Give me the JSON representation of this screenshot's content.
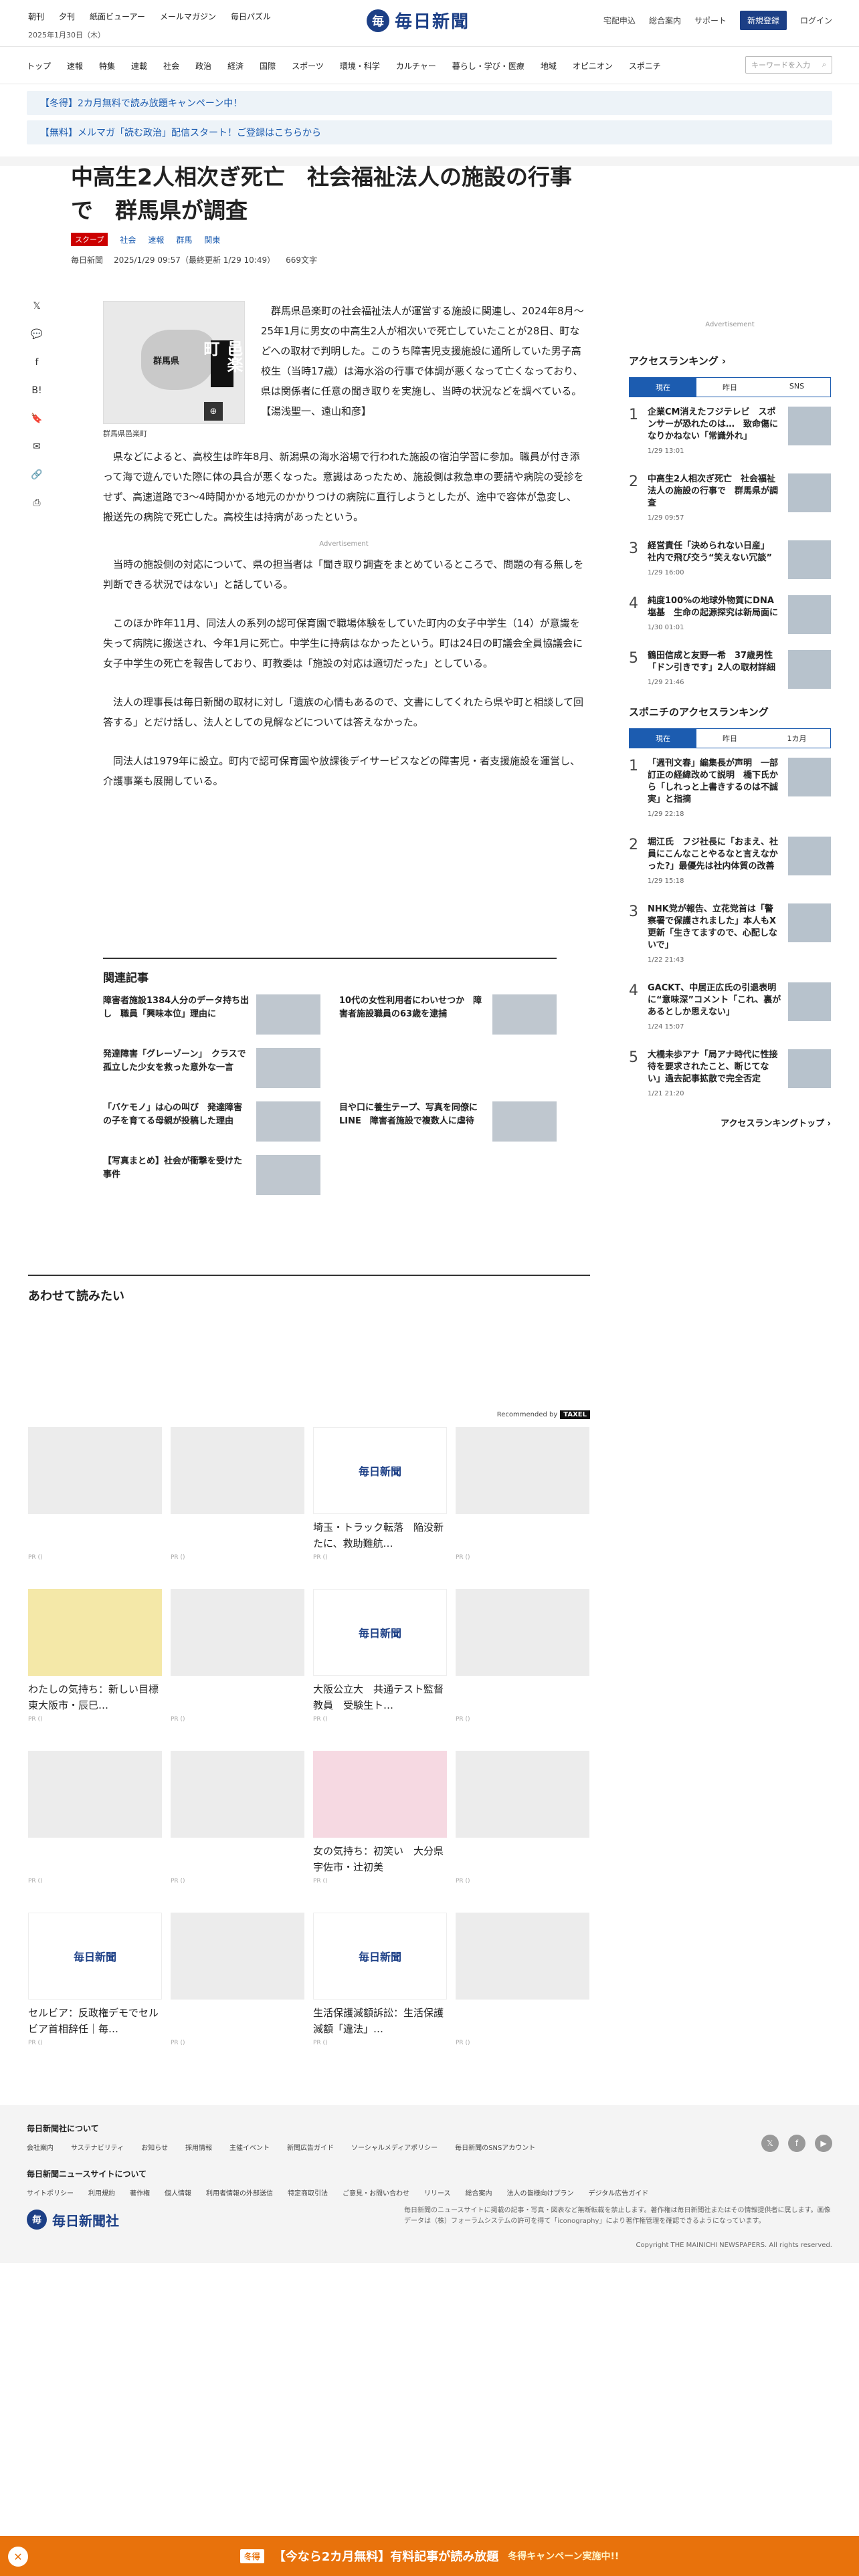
{
  "header": {
    "links": [
      "朝刊",
      "夕刊",
      "紙面ビューアー",
      "メールマガジン",
      "毎日パズル"
    ],
    "date": "2025年1月30日（木）",
    "logo": "毎日新聞",
    "right_links": [
      "宅配申込",
      "総合案内",
      "サポート"
    ],
    "register": "新規登録",
    "login": "ログイン"
  },
  "nav": {
    "items": [
      "トップ",
      "速報",
      "特集",
      "連載",
      "社会",
      "政治",
      "経済",
      "国際",
      "スポーツ",
      "環境・科学",
      "カルチャー",
      "暮らし・学び・医療",
      "地域",
      "オピニオン",
      "スポニチ"
    ],
    "search_placeholder": "キーワードを入力"
  },
  "banners": [
    "【冬得】2カ月無料で読み放題キャンペーン中！",
    "【無料】メルマガ「読む政治」配信スタート！ご登録はこちらから"
  ],
  "article": {
    "title": "中高生2人相次ぎ死亡　社会福祉法人の施設の行事で　群馬県が調査",
    "scoop": "スクープ",
    "tags": [
      "社会",
      "速報",
      "群馬",
      "関東"
    ],
    "source": "毎日新聞",
    "time": "2025/1/29 09:57（最終更新 1/29 10:49）",
    "chars": "669文字",
    "map_pref": "群馬県",
    "map_town": "邑楽町",
    "caption": "群馬県邑楽町",
    "paragraphs": [
      "群馬県邑楽町の社会福祉法人が運営する施設に関連し、2024年8月～25年1月に男女の中高生2人が相次いで死亡していたことが28日、町などへの取材で判明した。このうち障害児支援施設に通所していた男子高校生（当時17歳）は海水浴の行事で体調が悪くなって亡くなっており、県は関係者に任意の聞き取りを実施し、当時の状況などを調べている。【湯浅聖一、遠山和彦】",
      "県などによると、高校生は昨年8月、新潟県の海水浴場で行われた施設の宿泊学習に参加。職員が付き添って海で遊んでいた際に体の具合が悪くなった。意識はあったため、施設側は救急車の要請や病院の受診をせず、高速道路で3～4時間かかる地元のかかりつけの病院に直行しようとしたが、途中で容体が急変し、搬送先の病院で死亡した。高校生は持病があったという。",
      "当時の施設側の対応について、県の担当者は「聞き取り調査をまとめているところで、問題の有る無しを判断できる状況ではない」と話している。",
      "このほか昨年11月、同法人の系列の認可保育園で職場体験をしていた町内の女子中学生（14）が意識を失って病院に搬送され、今年1月に死亡。中学生に持病はなかったという。町は24日の町議会全員協議会に女子中学生の死亡を報告しており、町教委は「施設の対応は適切だった」としている。",
      "法人の理事長は毎日新聞の取材に対し「遺族の心情もあるので、文書にしてくれたら県や町と相談して回答する」とだけ話し、法人としての見解などについては答えなかった。",
      "同法人は1979年に設立。町内で認可保育園や放課後デイサービスなどの障害児・者支援施設を運営し、介護事業も展開している。"
    ],
    "ad_label": "Advertisement"
  },
  "related": {
    "heading": "関連記事",
    "items": [
      "障害者施設1384人分のデータ持ち出し　職員「興味本位」理由に",
      "10代の女性利用者にわいせつか　障害者施設職員の63歳を逮捕",
      "発達障害「グレーゾーン」　クラスで孤立した少女を救った意外な一言",
      "「バケモノ」は心の叫び　発達障害の子を育てる母親が投稿した理由",
      "目や口に養生テープ、写真を同僚にLINE　障害者施設で複数人に虐待",
      "【写真まとめ】社会が衝撃を受けた事件"
    ]
  },
  "recommend": {
    "heading": "あわせて読みたい",
    "by": "Recommended by",
    "by_brand": "TAXEL",
    "pr": "PR ()",
    "cards": [
      "",
      "",
      "埼玉・トラック転落　陥没新たに、救助難航…",
      "",
      "",
      "わたしの気持ち：新しい目標　東大阪市・辰巳…",
      "大阪公立大　共通テスト監督教員　受験生ト…",
      "",
      "",
      "",
      "女の気持ち：初笑い　大分県宇佐市・辻初美",
      "",
      "セルビア：反政権デモでセルビア首相辞任｜毎…",
      "",
      "生活保護減額訴訟：生活保護減額「違法」…",
      ""
    ]
  },
  "sidebar": {
    "ad": "Advertisement",
    "ranking_title": "アクセスランキング",
    "tabs": [
      "現在",
      "昨日",
      "SNS"
    ],
    "items": [
      {
        "n": "1",
        "t": "企業CM消えたフジテレビ　スポンサーが恐れたのは…　致命傷になりかねない「常識外れ」",
        "time": "1/29 13:01"
      },
      {
        "n": "2",
        "t": "中高生2人相次ぎ死亡　社会福祉法人の施設の行事で　群馬県が調査",
        "time": "1/29 09:57"
      },
      {
        "n": "3",
        "t": "経営責任「決められない日産」　社内で飛び交う“笑えない冗談”",
        "time": "1/29 16:00"
      },
      {
        "n": "4",
        "t": "純度100%の地球外物質にDNA塩基　生命の起源探究は新局面に",
        "time": "1/30 01:01"
      },
      {
        "n": "5",
        "t": "鶴田信成と友野一希　37歳男性「ドン引きです」2人の取材詳細",
        "time": "1/29 21:46"
      }
    ],
    "sponichi_title": "スポニチのアクセスランキング",
    "sponichi_tabs": [
      "現在",
      "昨日",
      "1カ月"
    ],
    "sponichi": [
      {
        "n": "1",
        "t": "「週刊文春」編集長が声明　一部訂正の経緯改めて説明　橋下氏から「しれっと上書きするのは不誠実」と指摘",
        "time": "1/29 22:18"
      },
      {
        "n": "2",
        "t": "堀江氏　フジ社長に「おまえ、社員にこんなことやるなと言えなかった?」最優先は社内体質の改善",
        "time": "1/29 15:18"
      },
      {
        "n": "3",
        "t": "NHK党が報告、立花党首は「警察署で保護されました」本人もX更新「生きてますので、心配しないで」",
        "time": "1/22 21:43"
      },
      {
        "n": "4",
        "t": "GACKT、中居正広氏の引退表明に“意味深”コメント「これ、裏があるとしか思えない」",
        "time": "1/24 15:07"
      },
      {
        "n": "5",
        "t": "大橋未歩アナ「局アナ時代に性接待を要求されたこと、断じてない」過去記事拡散で完全否定",
        "time": "1/21 21:20"
      }
    ],
    "more": "アクセスランキングトップ"
  },
  "footer": {
    "about_h": "毎日新聞社について",
    "about_links": [
      "会社案内",
      "サステナビリティ",
      "お知らせ",
      "採用情報",
      "主催イベント",
      "新聞広告ガイド",
      "ソーシャルメディアポリシー",
      "毎日新聞のSNSアカウント"
    ],
    "site_h": "毎日新聞ニュースサイトについて",
    "site_links": [
      "サイトポリシー",
      "利用規約",
      "著作権",
      "個人情報",
      "利用者情報の外部送信",
      "特定商取引法",
      "ご意見・お問い合わせ",
      "リリース",
      "総合案内",
      "法人の皆様向けプラン",
      "デジタル広告ガイド"
    ],
    "logo": "毎日新聞社",
    "note": "毎日新聞のニュースサイトに掲載の記事・写真・図表など無断転載を禁止します。著作権は毎日新聞社またはその情報提供者に属します。画像データは（株）フォーラムシステムの許可を得て「iconography」により著作権管理を確認できるようになっています。",
    "copyright": "Copyright THE MAINICHI NEWSPAPERS. All rights reserved."
  },
  "bottom": {
    "badge": "冬得",
    "main": "【今なら2カ月無料】有料記事が読み放題",
    "sub": "冬得キャンペーン実施中!!"
  }
}
